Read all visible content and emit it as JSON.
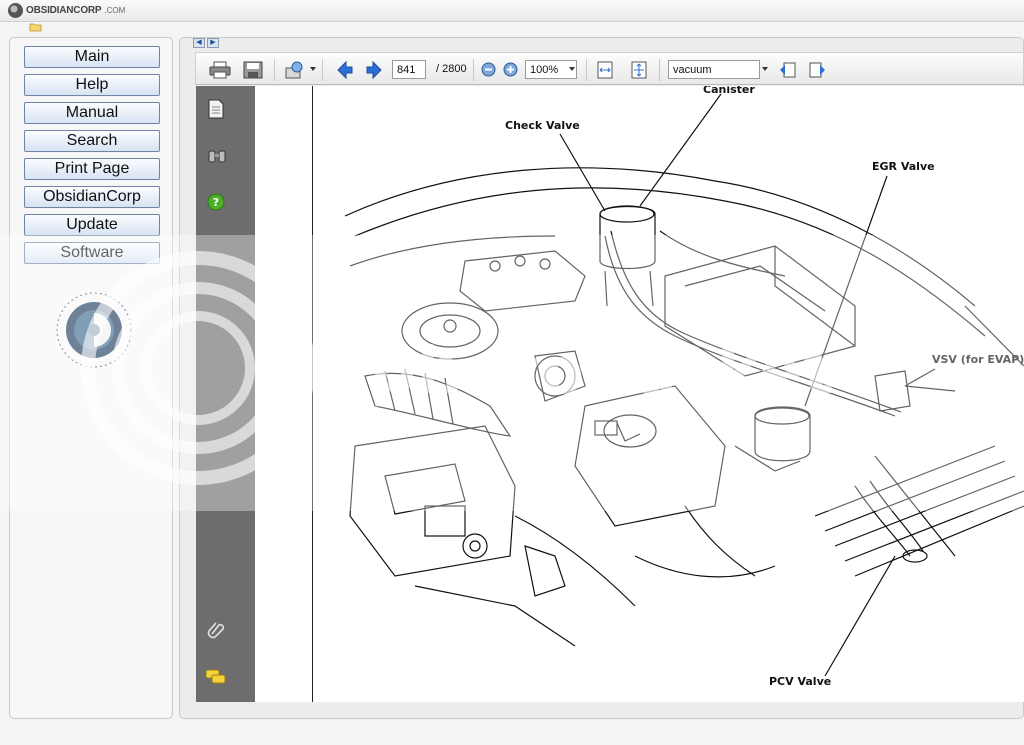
{
  "app": {
    "brand_name": "OBSIDIANCORP",
    "brand_domain": ".COM"
  },
  "nav": {
    "items": [
      {
        "label": "Main"
      },
      {
        "label": "Help"
      },
      {
        "label": "Manual"
      },
      {
        "label": "Search"
      },
      {
        "label": "Print Page"
      },
      {
        "label": "ObsidianCorp"
      },
      {
        "label": "Update"
      },
      {
        "label": "Software"
      }
    ]
  },
  "toolbar": {
    "current_page": "841",
    "page_separator": "/ 2800",
    "zoom_value": "100%",
    "search_value": "vacuum"
  },
  "icons": {
    "print": "print-icon",
    "save": "save-icon",
    "find": "find-icon",
    "prev": "arrow-left-icon",
    "next": "arrow-right-icon",
    "zoom_out": "zoom-out-icon",
    "zoom_in": "zoom-in-icon",
    "fit_width": "fit-width-icon",
    "fit_page": "fit-page-icon",
    "search_prev": "search-previous-icon",
    "search_next": "search-next-icon",
    "pages": "pages-icon",
    "bookmarks": "binoculars-icon",
    "help": "help-icon",
    "attachments": "paperclip-icon",
    "comments": "comments-icon"
  },
  "diagram": {
    "labels": {
      "canister": "Canister",
      "check_valve": "Check Valve",
      "egr_valve": "EGR Valve",
      "vsv": "VSV (for EVAP)",
      "pcv_valve": "PCV Valve"
    }
  },
  "watermark": {
    "text": "photobucket"
  },
  "colors": {
    "nav_button_border": "#6f85a8",
    "sidebar_bg": "#6d6d6d",
    "arrow_blue": "#2b6fd6"
  }
}
